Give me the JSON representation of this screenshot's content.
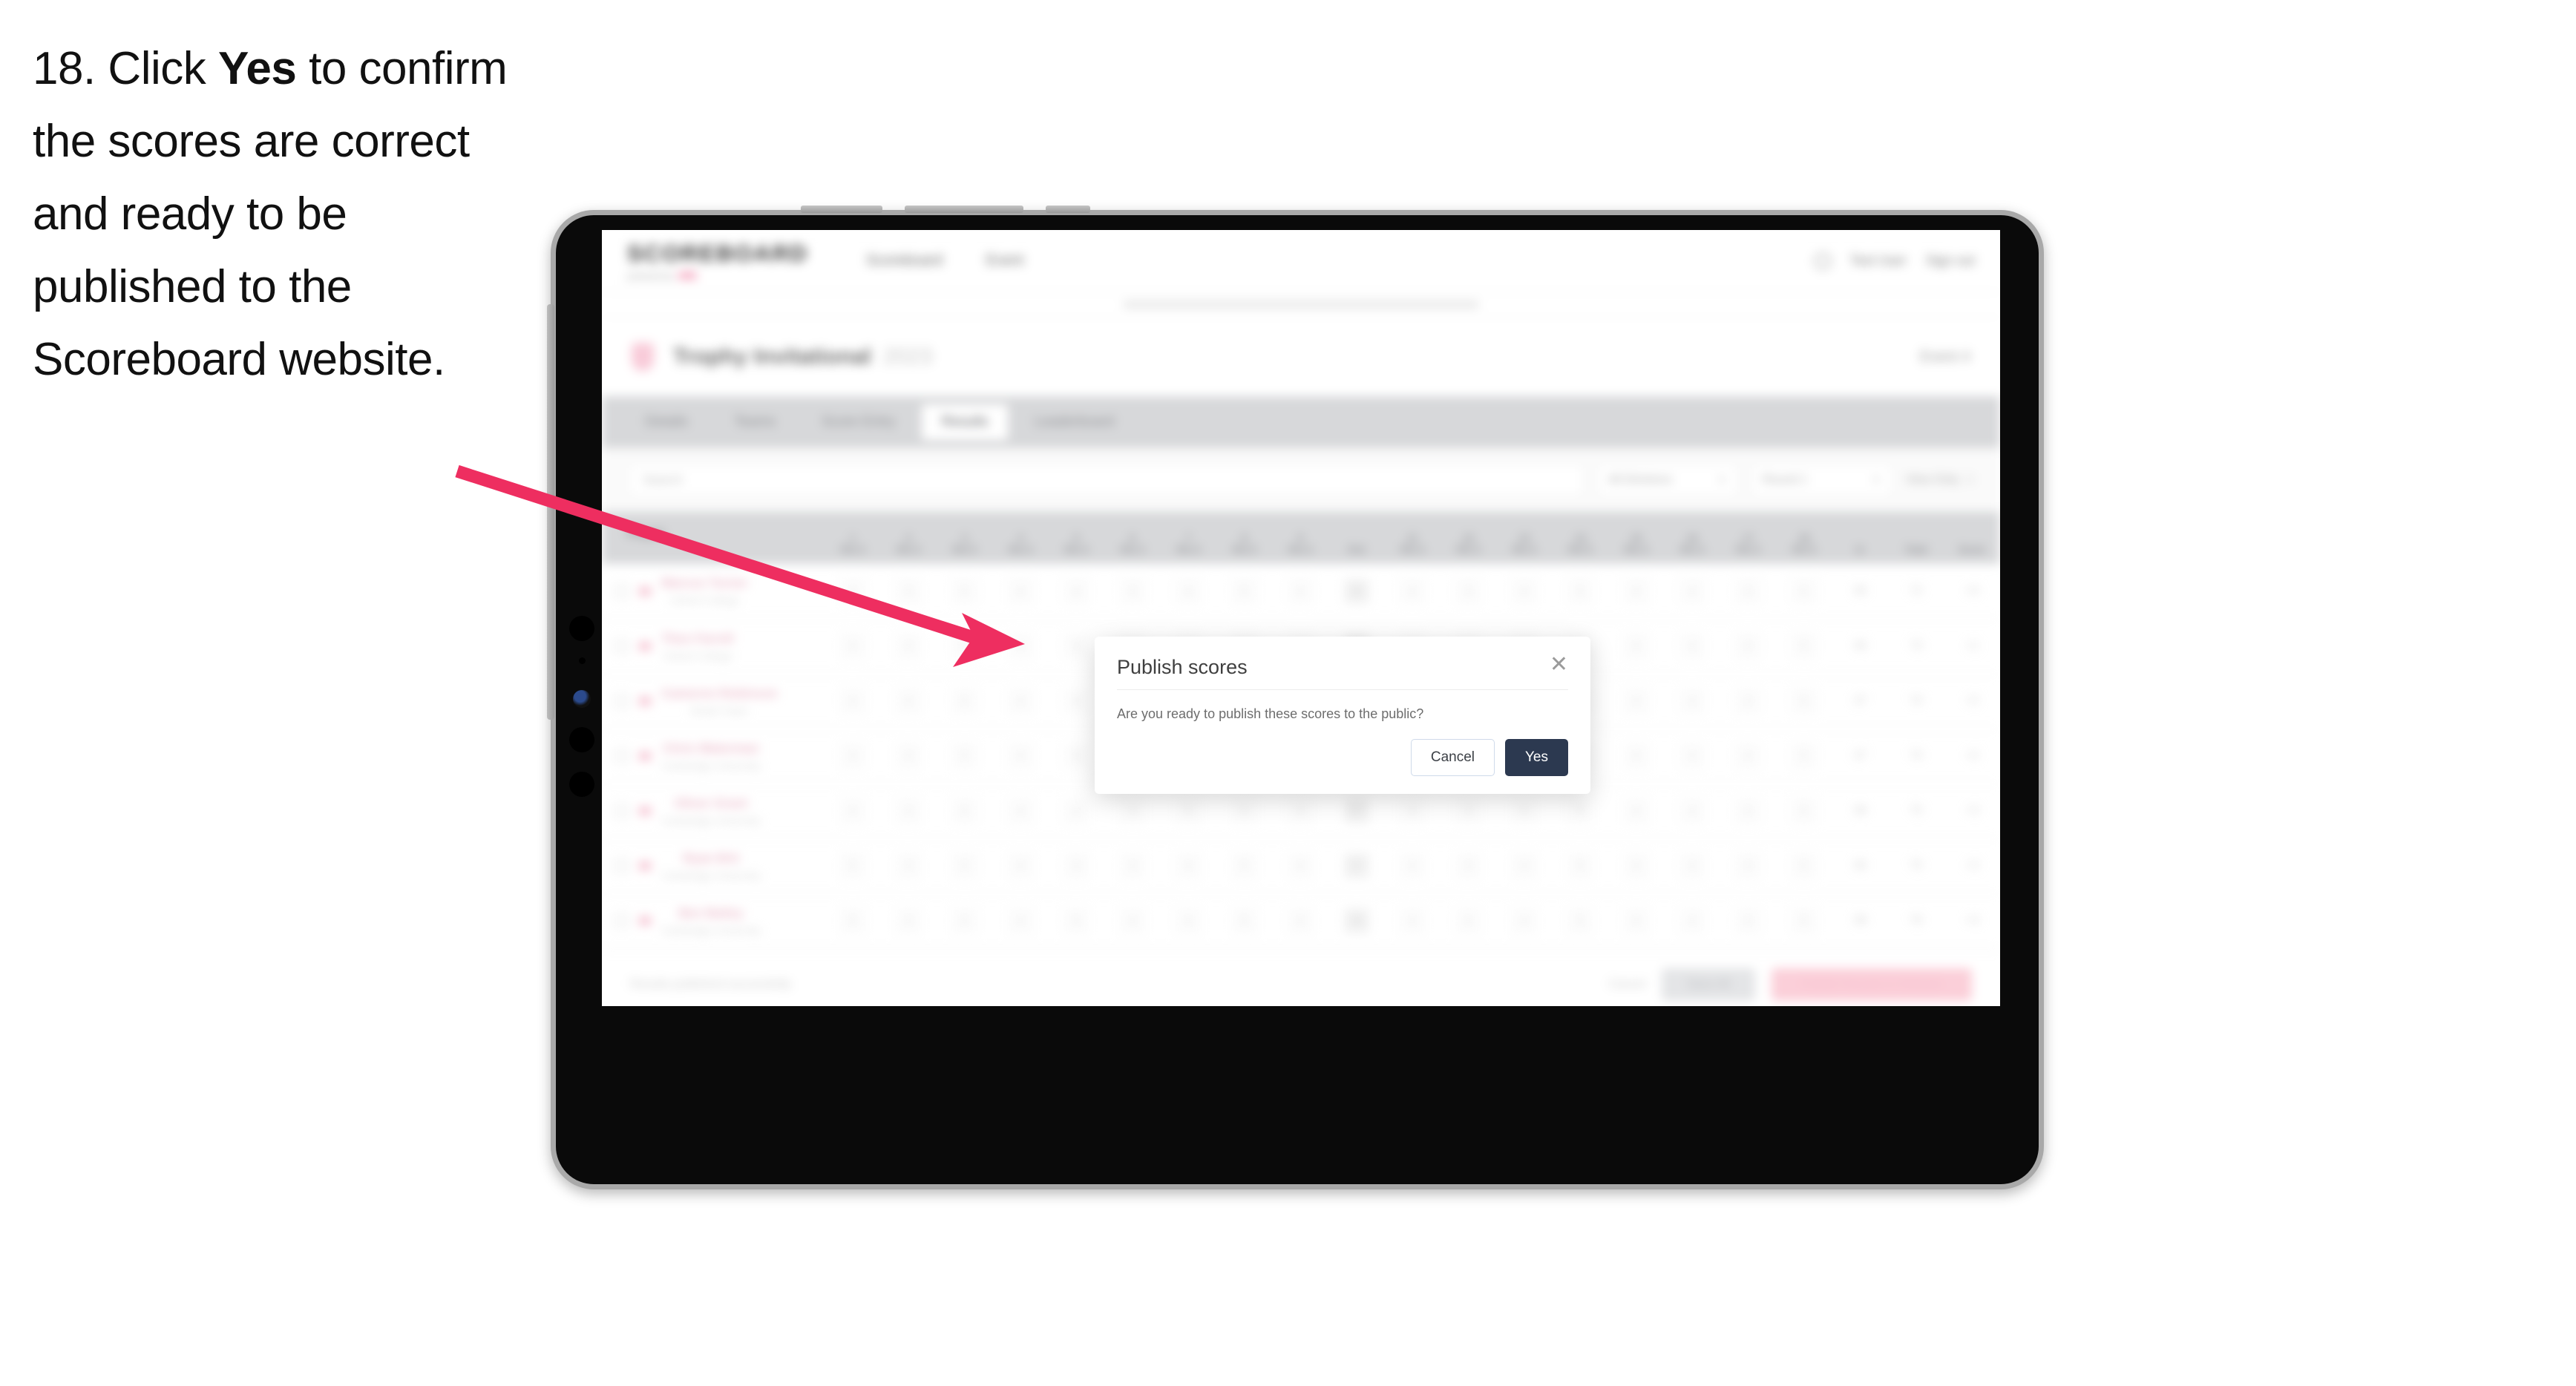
{
  "instruction": {
    "number": "18.",
    "before_bold": " Click ",
    "bold": "Yes",
    "after_bold": " to confirm the scores are correct and ready to be published to the Scoreboard website."
  },
  "colors": {
    "arrow": "#ee2e60",
    "primary_button": "#2c3950",
    "brand_pink": "#e8336d"
  },
  "app": {
    "header": {
      "logo": "SCOREBOARD",
      "logo_subtitle": "powered by",
      "logo_subtitle_accent": "HPE",
      "nav": [
        {
          "label": "Scoreboard"
        },
        {
          "label": "Event"
        }
      ],
      "user_name": "Test User",
      "sign_out": "Sign out"
    },
    "event": {
      "title": "Trophy Invitational",
      "year": "2023",
      "right_label": "Event 4"
    },
    "tabs": [
      {
        "label": "Details",
        "active": false
      },
      {
        "label": "Teams",
        "active": false
      },
      {
        "label": "Score Entry",
        "active": false
      },
      {
        "label": "Results",
        "active": true
      },
      {
        "label": "Leaderboard",
        "active": false
      }
    ],
    "filters": {
      "search_placeholder": "Search",
      "select_division": "All Divisions",
      "select_round": "Round 1",
      "view_only": "View Only"
    },
    "table": {
      "player_header": "Player",
      "hole_numbers": [
        "1",
        "2",
        "3",
        "4",
        "5",
        "6",
        "7",
        "8",
        "9",
        "10",
        "11",
        "12",
        "13",
        "14",
        "15",
        "16",
        "17",
        "18"
      ],
      "hole_subheaders": [
        "Par 4",
        "Par 3",
        "Par 5",
        "Par 4",
        "Par 4",
        "Par 3",
        "Par 4",
        "Par 5",
        "Par 4",
        "Out",
        "Par 4",
        "Par 3",
        "Par 4",
        "Par 5",
        "Par 4",
        "Par 4",
        "Par 3",
        "Par 5"
      ],
      "tail_headers": [
        "In",
        "Total",
        "Score"
      ],
      "rows": [
        {
          "name": "Marcus Turner",
          "team": "Oxford College",
          "scores": [
            "4",
            "3",
            "5",
            "4",
            "4",
            "3",
            "4",
            "5",
            "4",
            "36",
            "4",
            "3",
            "4",
            "5",
            "4",
            "4",
            "3",
            "5"
          ],
          "in": "36",
          "total": "72",
          "score": "+0",
          "net": "72"
        },
        {
          "name": "Theo Farrell",
          "team": "Oxford College",
          "scores": [
            "4",
            "3",
            "5",
            "4",
            "5",
            "3",
            "4",
            "5",
            "4",
            "37",
            "4",
            "3",
            "4",
            "5",
            "4",
            "4",
            "3",
            "5"
          ],
          "in": "36",
          "total": "73",
          "score": "+1",
          "net": "73"
        },
        {
          "name": "Cameron Robinson",
          "team": "Bristol Team",
          "scores": [
            "4",
            "4",
            "5",
            "4",
            "4",
            "3",
            "4",
            "5",
            "4",
            "37",
            "4",
            "4",
            "4",
            "5",
            "4",
            "4",
            "3",
            "5"
          ],
          "in": "37",
          "total": "74",
          "score": "+2",
          "net": "74"
        },
        {
          "name": "Chris Waterman",
          "team": "Cambridge University",
          "scores": [
            "4",
            "3",
            "5",
            "4",
            "5",
            "3",
            "4",
            "5",
            "4",
            "37",
            "4",
            "3",
            "4",
            "5",
            "4",
            "4",
            "4",
            "5"
          ],
          "in": "37",
          "total": "74",
          "score": "+2",
          "net": "74"
        },
        {
          "name": "Oliver Grant",
          "team": "Cambridge University",
          "scores": [
            "4",
            "3",
            "5",
            "4",
            "4",
            "3",
            "5",
            "5",
            "4",
            "37",
            "4",
            "3",
            "5",
            "5",
            "4",
            "4",
            "3",
            "5"
          ],
          "in": "38",
          "total": "75",
          "score": "+3",
          "net": "75"
        },
        {
          "name": "Ryan Brit",
          "team": "Cambridge University",
          "scores": [
            "5",
            "3",
            "5",
            "4",
            "4",
            "3",
            "4",
            "5",
            "4",
            "37",
            "4",
            "3",
            "4",
            "5",
            "4",
            "4",
            "3",
            "5"
          ],
          "in": "36",
          "total": "75",
          "score": "+3",
          "net": "75"
        },
        {
          "name": "Ben Bailey",
          "team": "Cambridge University",
          "scores": [
            "5",
            "3",
            "5",
            "4",
            "5",
            "4",
            "4",
            "5",
            "4",
            "39",
            "4",
            "4",
            "4",
            "5",
            "4",
            "4",
            "3",
            "5"
          ],
          "in": "38",
          "total": "76",
          "score": "+4",
          "net": "76"
        }
      ]
    },
    "footer": {
      "note": "Results published successfully",
      "cancel": "Cancel",
      "save": "Save All",
      "publish": "Publish Results to Website"
    }
  },
  "modal": {
    "title": "Publish scores",
    "close_icon": "close-icon",
    "body": "Are you ready to publish these scores to the public?",
    "cancel_label": "Cancel",
    "yes_label": "Yes"
  }
}
